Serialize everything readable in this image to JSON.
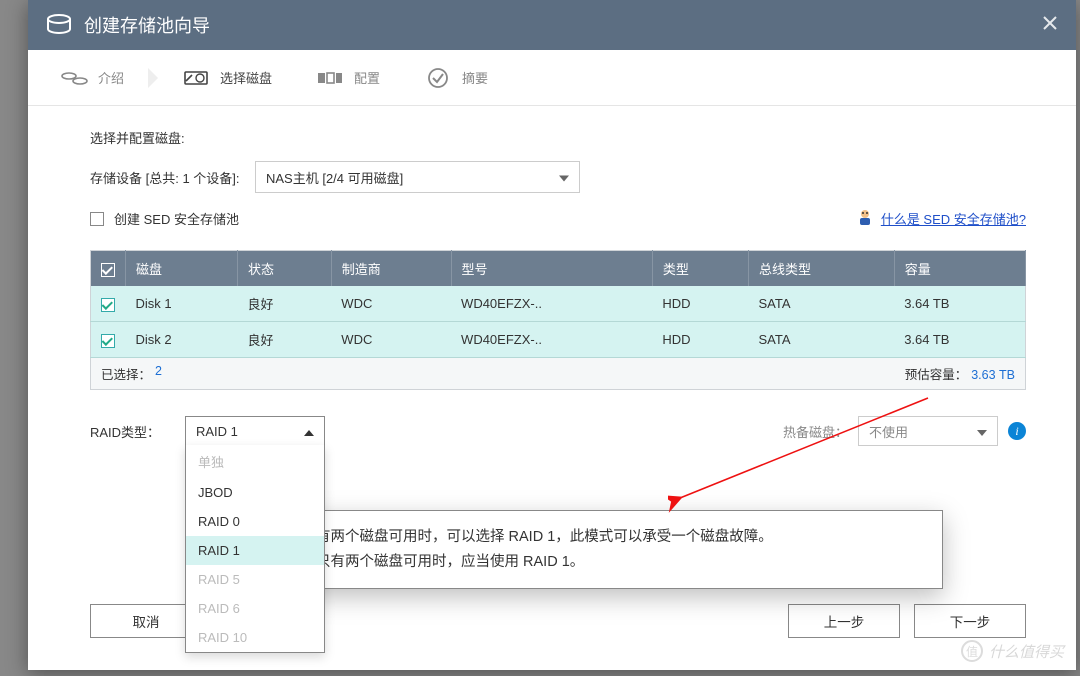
{
  "window": {
    "title": "创建存储池向导"
  },
  "steps": {
    "intro": "介绍",
    "select_disk": "选择磁盘",
    "configure": "配置",
    "summary": "摘要"
  },
  "section_title": "选择并配置磁盘:",
  "storage_device": {
    "label": "存储设备 [总共: 1 个设备]:",
    "value": "NAS主机 [2/4 可用磁盘]"
  },
  "sed": {
    "label": "创建 SED 安全存储池",
    "link": "什么是 SED 安全存储池?"
  },
  "table": {
    "headers": {
      "disk": "磁盘",
      "status": "状态",
      "maker": "制造商",
      "model": "型号",
      "type": "类型",
      "bus": "总线类型",
      "cap": "容量"
    },
    "rows": [
      {
        "disk": "Disk 1",
        "status": "良好",
        "maker": "WDC",
        "model": "WD40EFZX-..",
        "type": "HDD",
        "bus": "SATA",
        "cap": "3.64 TB"
      },
      {
        "disk": "Disk 2",
        "status": "良好",
        "maker": "WDC",
        "model": "WD40EFZX-..",
        "type": "HDD",
        "bus": "SATA",
        "cap": "3.64 TB"
      }
    ]
  },
  "legend": {
    "selected_lbl": "已选择：",
    "selected_n": "2",
    "cap_lbl": "预估容量：",
    "cap_n": "3.63 TB"
  },
  "raid": {
    "label": "RAID类型：",
    "current": "RAID 1",
    "options": [
      {
        "label": "单独",
        "enabled": false
      },
      {
        "label": "JBOD",
        "enabled": true
      },
      {
        "label": "RAID 0",
        "enabled": true
      },
      {
        "label": "RAID 1",
        "enabled": true,
        "selected": true
      },
      {
        "label": "RAID 5",
        "enabled": false
      },
      {
        "label": "RAID 6",
        "enabled": false
      },
      {
        "label": "RAID 10",
        "enabled": false
      }
    ]
  },
  "hotspare": {
    "label": "热备磁盘：",
    "value": "不使用"
  },
  "tooltip": {
    "line1": "有两个磁盘可用时，可以选择 RAID 1，此模式可以承受一个磁盘故障。",
    "line2": "只有两个磁盘可用时，应当使用 RAID 1。"
  },
  "buttons": {
    "cancel": "取消",
    "prev": "上一步",
    "next": "下一步"
  },
  "watermark": "什么值得买"
}
